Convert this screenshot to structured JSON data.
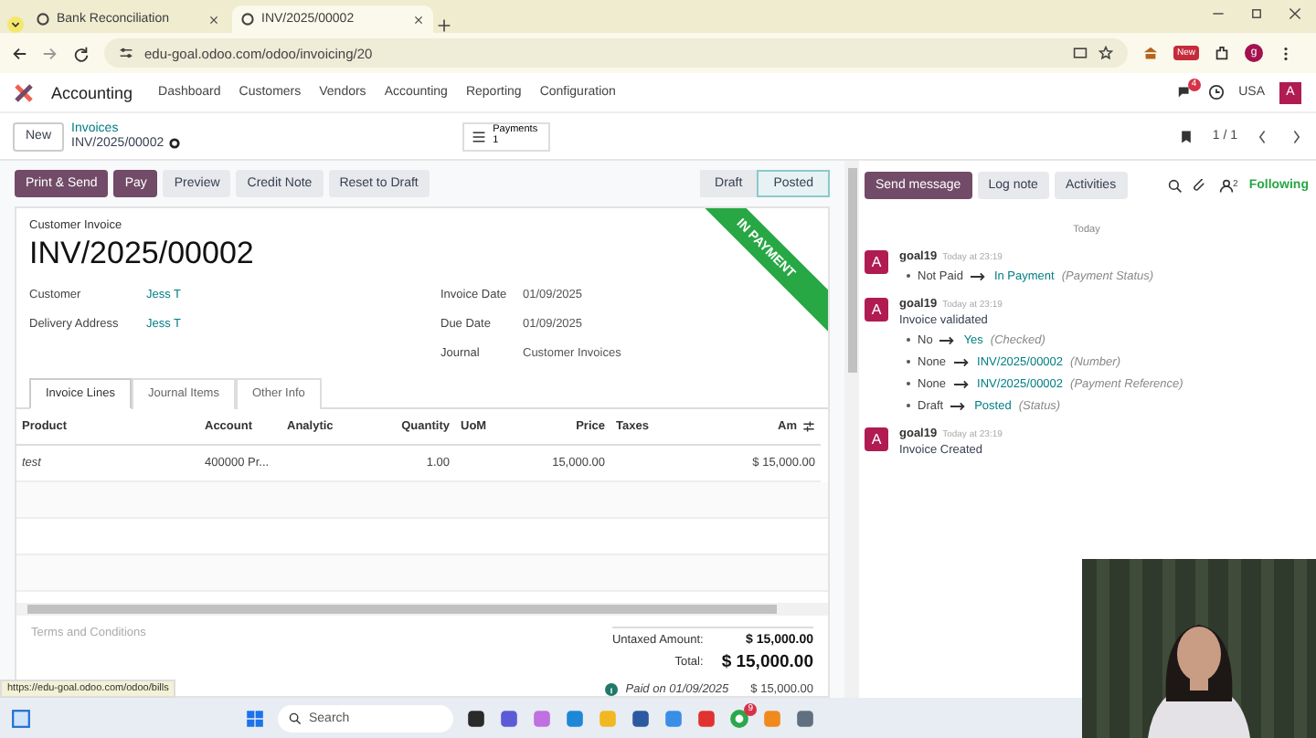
{
  "browser": {
    "tabs": [
      {
        "title": "Bank Reconciliation",
        "selected": false
      },
      {
        "title": "INV/2025/00002",
        "selected": true
      }
    ],
    "url": "edu-goal.odoo.com/odoo/invoicing/20",
    "extension_badge": "New",
    "profile": "g"
  },
  "navbar": {
    "app": "Accounting",
    "menu": [
      "Dashboard",
      "Customers",
      "Vendors",
      "Accounting",
      "Reporting",
      "Configuration"
    ],
    "chat_count": "4",
    "company": "USA",
    "avatar": "A"
  },
  "control_panel": {
    "new_button": "New",
    "breadcrumb_parent": "Invoices",
    "breadcrumb_current": "INV/2025/00002",
    "smart_button": {
      "label": "Payments",
      "count": "1"
    },
    "pager": "1 / 1"
  },
  "actions": [
    {
      "label": "Print & Send",
      "primary": true
    },
    {
      "label": "Pay",
      "primary": true
    },
    {
      "label": "Preview",
      "primary": false
    },
    {
      "label": "Credit Note",
      "primary": false
    },
    {
      "label": "Reset to Draft",
      "primary": false
    }
  ],
  "status_steps": [
    {
      "label": "Draft",
      "selected": false
    },
    {
      "label": "Posted",
      "selected": true
    }
  ],
  "form": {
    "subtitle": "Customer Invoice",
    "title": "INV/2025/00002",
    "ribbon": "IN PAYMENT",
    "left_fields": [
      {
        "label": "Customer",
        "value": "Jess T",
        "link": true
      },
      {
        "label": "Delivery Address",
        "value": "Jess T",
        "link": true
      }
    ],
    "right_fields": [
      {
        "label": "Invoice Date",
        "value": "01/09/2025",
        "link": false
      },
      {
        "label": "Due Date",
        "value": "01/09/2025",
        "link": false
      },
      {
        "label": "Journal",
        "value": "Customer Invoices",
        "link": false
      }
    ],
    "tabs": [
      {
        "label": "Invoice Lines",
        "selected": true
      },
      {
        "label": "Journal Items",
        "selected": false
      },
      {
        "label": "Other Info",
        "selected": false
      }
    ],
    "columns": [
      "Product",
      "Account",
      "Analytic",
      "Quantity",
      "UoM",
      "Price",
      "Taxes",
      "Am"
    ],
    "rows": [
      [
        "test",
        "400000 Pr...",
        "",
        "1.00",
        "",
        "15,000.00",
        "",
        "$ 15,000.00"
      ]
    ],
    "terms_placeholder": "Terms and Conditions",
    "totals": [
      {
        "label": "Untaxed Amount:",
        "value": "$ 15,000.00",
        "kind": "sub"
      },
      {
        "label": "Total:",
        "value": "$ 15,000.00",
        "kind": "grand"
      }
    ],
    "paid": {
      "label": "Paid on 01/09/2025",
      "value": "$ 15,000.00"
    }
  },
  "chatter": {
    "buttons": [
      {
        "label": "Send message",
        "primary": true
      },
      {
        "label": "Log note",
        "primary": false
      },
      {
        "label": "Activities",
        "primary": false
      }
    ],
    "followers": "2",
    "following": "Following",
    "date": "Today",
    "messages": [
      {
        "author": "goal19",
        "avatar": "A",
        "time": "Today at 23:19",
        "changes": [
          {
            "old": "Not Paid",
            "new": "In Payment",
            "field": "(Payment Status)"
          }
        ]
      },
      {
        "author": "goal19",
        "avatar": "A",
        "time": "Today at 23:19",
        "body": "Invoice validated",
        "changes": [
          {
            "old": "No",
            "new": "Yes",
            "field": "(Checked)"
          },
          {
            "old": "None",
            "new": "INV/2025/00002",
            "field": "(Number)"
          },
          {
            "old": "None",
            "new": "INV/2025/00002",
            "field": "(Payment Reference)"
          },
          {
            "old": "Draft",
            "new": "Posted",
            "field": "(Status)"
          }
        ]
      },
      {
        "author": "goal19",
        "avatar": "A",
        "time": "Today at 23:19",
        "body": "Invoice Created"
      }
    ]
  },
  "status_url": "https://edu-goal.odoo.com/odoo/bills",
  "taskbar": {
    "search": "Search",
    "chrome_badge": "9"
  }
}
